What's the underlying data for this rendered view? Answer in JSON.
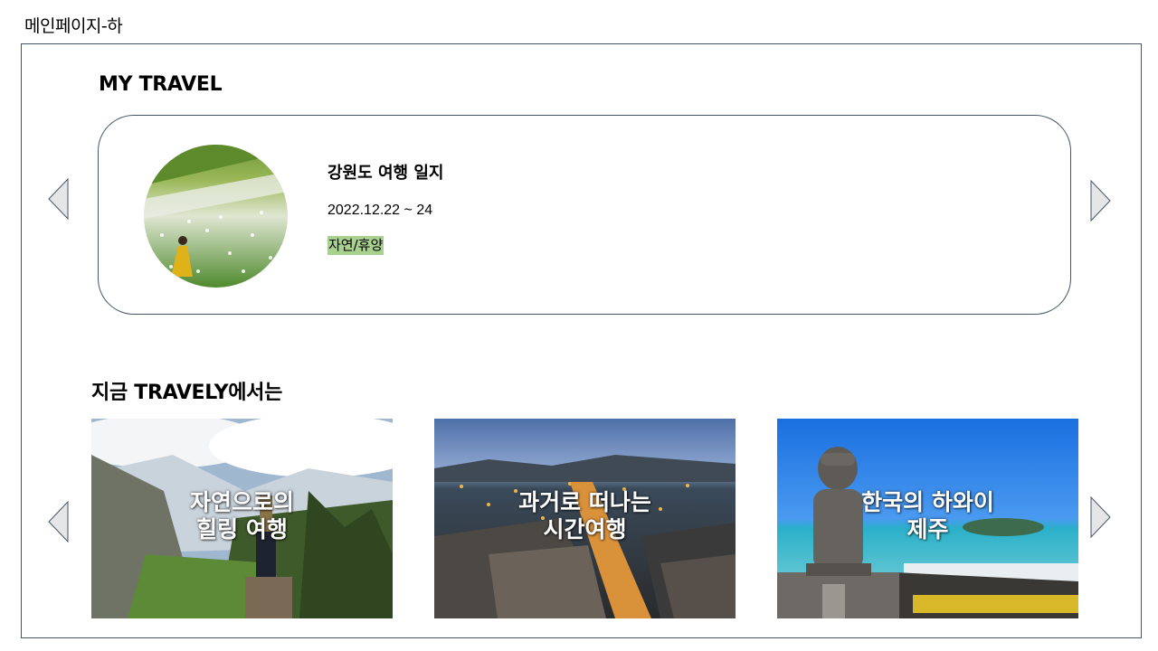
{
  "page_label": "메인페이지-하",
  "my_travel": {
    "title": "MY TRAVEL",
    "trip": {
      "title": "강원도 여행 일지",
      "date": "2022.12.22 ~ 24",
      "tag": "자연/휴양",
      "tag_color": "#a9d18e"
    }
  },
  "recommend": {
    "title": "지금 TRAVELY에서는",
    "cards": [
      {
        "line1": "자연으로의",
        "line2": "힐링 여행"
      },
      {
        "line1": "과거로 떠나는",
        "line2": "시간여행"
      },
      {
        "line1": "한국의 하와이",
        "line2": "제주"
      }
    ]
  },
  "icons": {
    "prev": "chevron-left-icon",
    "next": "chevron-right-icon"
  },
  "colors": {
    "border": "#44546a",
    "arrow_fill": "#e7e6e6"
  }
}
